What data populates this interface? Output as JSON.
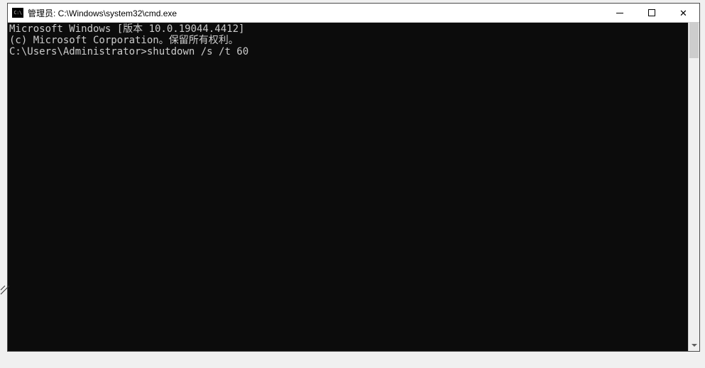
{
  "titlebar": {
    "icon_label": "cmd-icon",
    "title": "管理员: C:\\Windows\\system32\\cmd.exe"
  },
  "window_controls": {
    "minimize": "minimize",
    "maximize": "maximize",
    "close": "close"
  },
  "terminal": {
    "line1": "Microsoft Windows [版本 10.0.19044.4412]",
    "line2": "(c) Microsoft Corporation。保留所有权利。",
    "blank": "",
    "prompt": "C:\\Users\\Administrator>",
    "command": "shutdown /s /t 60"
  }
}
